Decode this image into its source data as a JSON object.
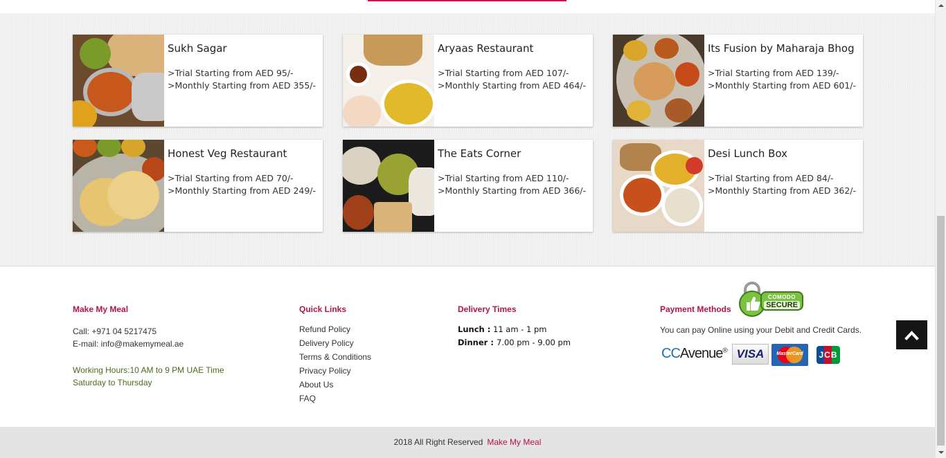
{
  "restaurants": [
    {
      "name": "Sukh Sagar",
      "trial": ">Trial Starting from AED 95/-",
      "monthly": ">Monthly Starting from AED 355/-"
    },
    {
      "name": "Aryaas Restaurant",
      "trial": ">Trial Starting from AED 107/-",
      "monthly": ">Monthly Starting from AED 464/-"
    },
    {
      "name": "Its Fusion by Maharaja Bhog",
      "trial": ">Trial Starting from AED 139/-",
      "monthly": ">Monthly Starting from AED 601/-"
    },
    {
      "name": "Honest Veg Restaurant",
      "trial": ">Trial Starting from AED 70/-",
      "monthly": ">Monthly Starting from AED 249/-"
    },
    {
      "name": "The Eats Corner",
      "trial": ">Trial Starting from AED 110/-",
      "monthly": ">Monthly Starting from AED 366/-"
    },
    {
      "name": "Desi Lunch Box",
      "trial": ">Trial Starting from AED 84/-",
      "monthly": ">Monthly Starting from AED 362/-"
    }
  ],
  "footer": {
    "about": {
      "heading": "Make My Meal",
      "call": "Call: +971 04 5217475",
      "email": "E-mail: info@makemymeal.ae",
      "hours": "Working Hours:10 AM to 9 PM UAE Time",
      "days": "Saturday to Thursday"
    },
    "quick_links": {
      "heading": "Quick Links",
      "items": [
        "Refund Policy",
        "Delivery Policy",
        "Terms & Conditions",
        "Privacy Policy",
        "About Us",
        "FAQ"
      ]
    },
    "delivery": {
      "heading": "Delivery Times",
      "lunch_label": "Lunch  :",
      "lunch_time": "11 am - 1 pm",
      "dinner_label": "Dinner  :",
      "dinner_time": "7.00 pm - 9.00 pm"
    },
    "payment": {
      "heading": "Payment Methods",
      "text": "You can pay Online using your Debit and Credit Cards.",
      "comodo_top": "COMODO",
      "comodo_bottom": "SECURE",
      "ccavenue_cc": "CC",
      "ccavenue_rest": "Avenue",
      "visa": "VISA",
      "mastercard": "MasterCard",
      "jcb": "JCB"
    }
  },
  "copyright": {
    "text": "2018 All Right Reserved",
    "brand": "Make My Meal"
  },
  "colors": {
    "accent": "#b0144c",
    "section_bg": "#efefef",
    "footer_bar": "#e4e4e4",
    "green_text": "#4e6a1c"
  },
  "icons": {
    "scroll_top": "chevron-up-icon",
    "comodo": "thumbs-up-lock-icon"
  }
}
